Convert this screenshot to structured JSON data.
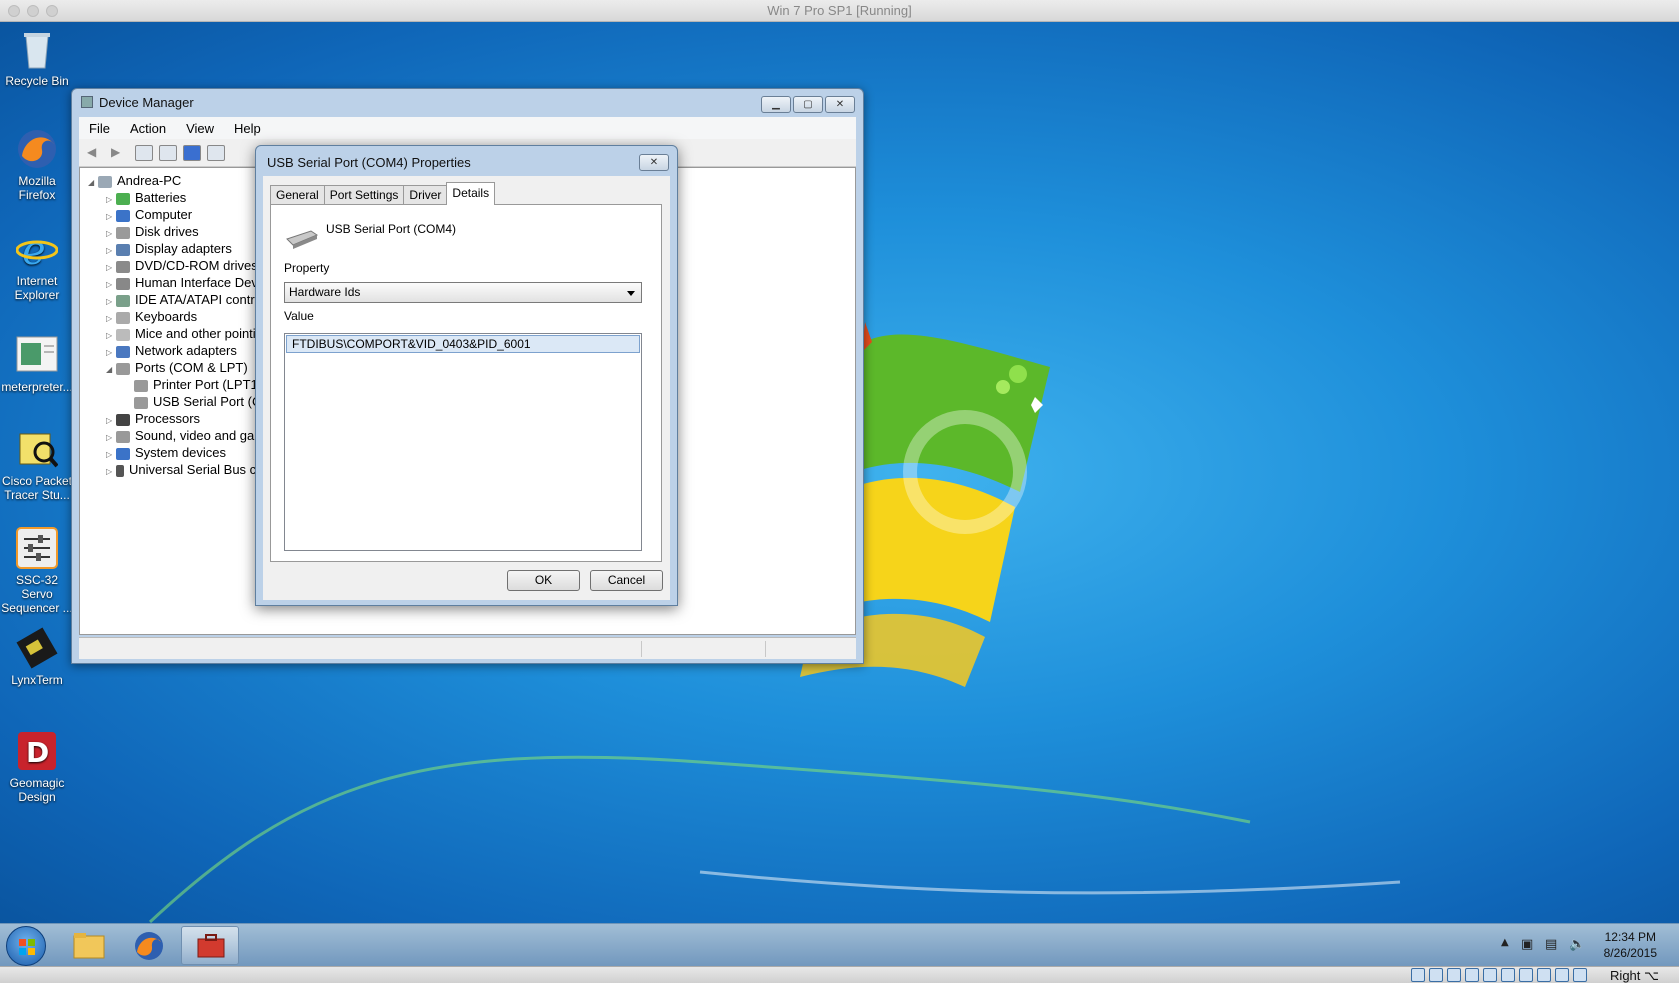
{
  "host": {
    "window_title": "Win 7 Pro SP1 [Running]",
    "host_key": "Right ⌥"
  },
  "desktop_icons": [
    {
      "label": "Recycle Bin"
    },
    {
      "label": "Mozilla Firefox"
    },
    {
      "label": "Internet Explorer"
    },
    {
      "label": "meterpreter..."
    },
    {
      "label": "Cisco Packet Tracer Stu..."
    },
    {
      "label": "SSC-32 Servo Sequencer ..."
    },
    {
      "label": "LynxTerm"
    },
    {
      "label": "Geomagic Design"
    }
  ],
  "device_manager": {
    "title": "Device Manager",
    "menu": [
      "File",
      "Action",
      "View",
      "Help"
    ],
    "tree": {
      "root": "Andrea-PC",
      "items": [
        "Batteries",
        "Computer",
        "Disk drives",
        "Display adapters",
        "DVD/CD-ROM drives",
        "Human Interface Devi",
        "IDE ATA/ATAPI contro",
        "Keyboards",
        "Mice and other pointi",
        "Network adapters",
        "Ports (COM & LPT)",
        "Printer Port (LPT1)",
        "USB Serial Port (CO",
        "Processors",
        "Sound, video and gan",
        "System devices",
        "Universal Serial Bus co"
      ]
    }
  },
  "properties_dialog": {
    "title": "USB Serial Port (COM4) Properties",
    "tabs": [
      "General",
      "Port Settings",
      "Driver",
      "Details"
    ],
    "active_tab": "Details",
    "device_name": "USB Serial Port (COM4)",
    "property_label": "Property",
    "property_value": "Hardware Ids",
    "value_label": "Value",
    "values": [
      "FTDIBUS\\COMPORT&VID_0403&PID_6001"
    ],
    "ok_label": "OK",
    "cancel_label": "Cancel"
  },
  "taskbar": {
    "time": "12:34 PM",
    "date": "8/26/2015"
  },
  "colors": {
    "desktop_blue": "#1e8fda",
    "selection": "#dbe8f6"
  }
}
